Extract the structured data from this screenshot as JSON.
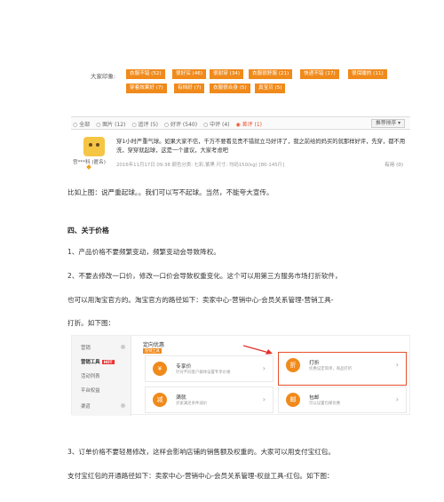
{
  "review_tags": {
    "label": "大家印象:",
    "tags": [
      "衣服不错 (52)",
      "很好实 (46)",
      "很耐穿 (34)",
      "衣服很舒服 (21)",
      "快递不错 (17)",
      "很保暖的 (11)",
      "穿着效果好 (7)",
      "有档好 (7)",
      "衣服很合身 (5)",
      "真宝贝 (5)"
    ]
  },
  "filter_bar": {
    "options": [
      "○ 全部",
      "○ 图片 (12)",
      "○ 追评 (5)",
      "○ 好评 (540)",
      "○ 中评 (4)",
      "◉ 差评 (1)"
    ],
    "sort_label": "推荐排序"
  },
  "review": {
    "text": "穿1小时严重气球。如果大家不信，千万不要看见贵不错就立马好评了，我之前给妈妈买的就那样好评，先穿，都不用洗，穿穿就起球，这是一个建议，大家考虑吧",
    "nickname": "宫***科 (匿名)",
    "meta": "2016年11月17日 09:38    颜色分类: 七彩,紫黑  尺寸: 均码150(kg) [80-145斤]",
    "useful": "有用 (0)"
  },
  "article": {
    "p1": "比如上图：说严重起球。。我们可以写不起球。当然，不能夸大宣传。",
    "h_price": "四、关于价格",
    "p2": "1、产品价格不要频繁变动，频繁变动会导致降权。",
    "p3": "2、不要去修改一口价，修改一口价会导致权重变化。这个可以用第三方服务市场打折软件，",
    "p4": "也可以用淘宝官方的。淘宝官方的路径如下：卖家中心-营销中心-会员关系管理-营销工具-",
    "p5": "打折。如下图：",
    "p6": "3、订单价格不要轻易修改，这样会影响店铺的销售额及权重的。大家可以用支付宝红包。",
    "p7": "支付宝红包的开通路径如下：卖家中心-营销中心-会员关系管理-权益工具-红包。如下图："
  },
  "screenshot": {
    "side_items": [
      "营销",
      "营销工具",
      "活动列表",
      "平台权益",
      "渠道"
    ],
    "hot": "HOT",
    "title": "定向优惠",
    "tag": "营销工具",
    "cards": [
      {
        "name": "专享价",
        "desc": "针对不同客户群体设置专享价格",
        "icon": "¥"
      },
      {
        "name": "打折",
        "desc": "优惠设定简单，商品打折",
        "icon": "折"
      },
      {
        "name": "满就",
        "desc": "买家满足条件减价",
        "icon": "减"
      },
      {
        "name": "包邮",
        "desc": "可以设置包邮优惠",
        "icon": "邮"
      }
    ]
  }
}
